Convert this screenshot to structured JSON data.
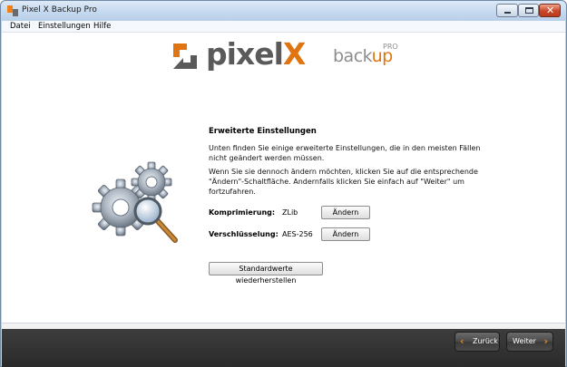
{
  "window": {
    "title": "Pixel X Backup Pro",
    "icon": "pixelx-app-icon"
  },
  "menu": {
    "items": [
      "Datei",
      "Einstellungen",
      "Hilfe"
    ]
  },
  "logo": {
    "brand_main": "pixel",
    "brand_x": "X",
    "product_back": "back",
    "product_up": "up",
    "product_pro": "PRO",
    "accent_color": "#e07410"
  },
  "settings": {
    "heading": "Erweiterte Einstellungen",
    "paragraph1": "Unten finden Sie einige erweiterte Einstellungen, die in den meisten Fällen nicht geändert werden müssen.",
    "paragraph2": "Wenn Sie sie dennoch ändern möchten, klicken Sie auf die entsprechende \"Ändern\"-Schaltfläche. Andernfalls klicken Sie einfach auf \"Weiter\" um fortzufahren.",
    "compression_label": "Komprimierung:",
    "compression_value": "ZLib",
    "encryption_label": "Verschlüsselung:",
    "encryption_value": "AES-256",
    "change_label": "Ändern",
    "reset_label": "Standardwerte wiederherstellen"
  },
  "footer": {
    "back_label": "Zurück",
    "next_label": "Weiter"
  }
}
